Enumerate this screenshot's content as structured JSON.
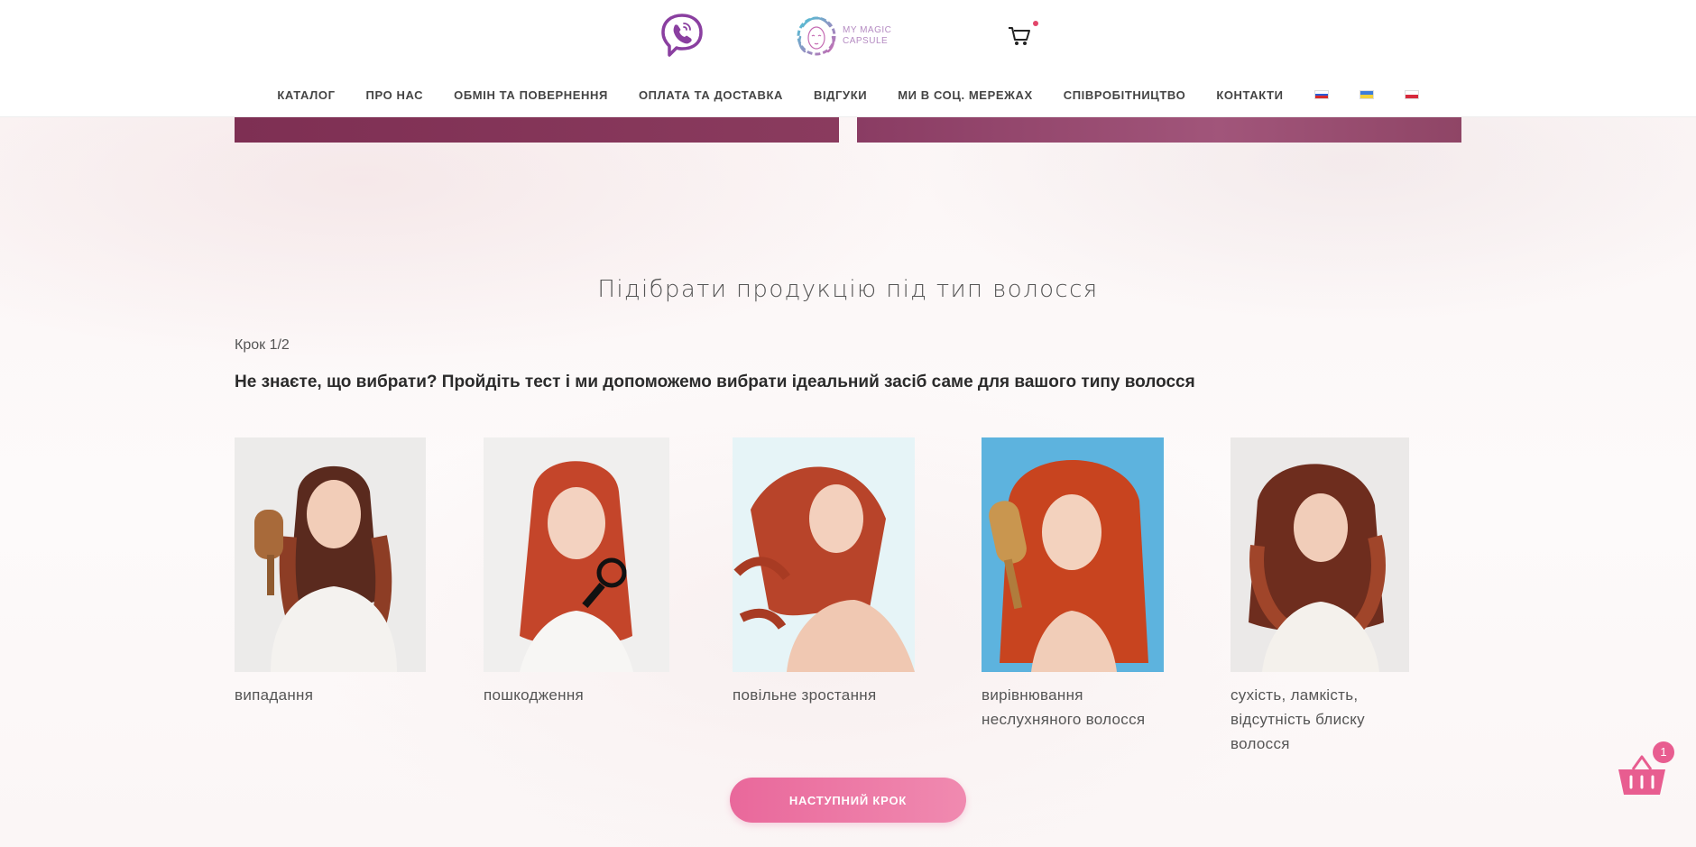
{
  "header": {
    "logo_text_line1": "MY MAGIC",
    "logo_text_line2": "CAPSULE",
    "nav": [
      "КАТАЛОГ",
      "ПРО НАС",
      "ОБМІН ТА ПОВЕРНЕННЯ",
      "ОПЛАТА ТА ДОСТАВКА",
      "ВІДГУКИ",
      "МИ В СОЦ. МЕРЕЖАХ",
      "СПІВРОБІТНИЦТВО",
      "КОНТАКТИ"
    ],
    "flags": [
      "ru-flag",
      "ua-flag",
      "pl-flag"
    ]
  },
  "quiz": {
    "title": "Підібрати продукцію під тип волосся",
    "step": "Крок 1/2",
    "question": "Не знаєте, що вибрати? Пройдіть тест і ми допоможемо вибрати ідеальний засіб саме для вашого типу волосся",
    "options": [
      {
        "label": "випадання"
      },
      {
        "label": "пошкодження"
      },
      {
        "label": "повільне зростання"
      },
      {
        "label": "вирівнювання неслухняного волосся"
      },
      {
        "label": "сухість, ламкість, відсутність блиску волосся"
      }
    ],
    "next_label": "НАСТУПНИЙ КРОК"
  },
  "cart": {
    "count": "1"
  },
  "colors": {
    "accent": "#e9689b",
    "banner": "#7e2f53",
    "viber": "#8a3fa0"
  }
}
